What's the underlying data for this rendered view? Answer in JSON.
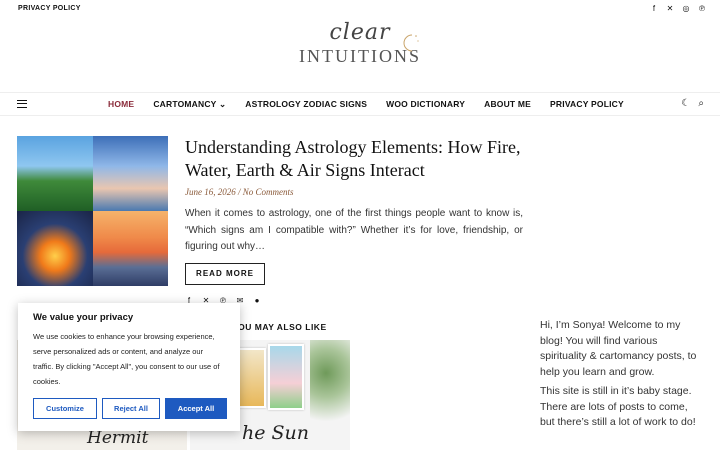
{
  "topbar": {
    "privacy_link": "PRIVACY POLICY",
    "social_icons": [
      "facebook-icon",
      "x-icon",
      "instagram-icon",
      "pinterest-icon"
    ]
  },
  "logo": {
    "script_text": "clear",
    "main_text": "INTUITIONS"
  },
  "nav": {
    "items": [
      {
        "label": "HOME",
        "active": true
      },
      {
        "label": "CARTOMANCY ⌄"
      },
      {
        "label": "ASTROLOGY ZODIAC SIGNS"
      },
      {
        "label": "WOO DICTIONARY"
      },
      {
        "label": "ABOUT ME"
      },
      {
        "label": "PRIVACY POLICY"
      }
    ]
  },
  "post": {
    "title": "Understanding Astrology Elements: How Fire, Water, Earth & Air Signs Interact",
    "meta": "June 16, 2026 / No Comments",
    "excerpt": "When it comes to astrology, one of the first things people want to know is, “Which signs am I compatible with?” Whether it’s for love, friendship, or figuring out why…",
    "read_more": "READ MORE"
  },
  "related": {
    "heading": "YOU MAY ALSO LIKE",
    "cards": [
      {
        "label": "Hermit"
      },
      {
        "label": "he Sun"
      }
    ]
  },
  "sidebar": {
    "intro": "Hi, I’m Sonya! Welcome to my blog! You will find various spirituality & cartomancy posts, to help you learn and grow.",
    "note": "This site is still in it’s baby stage. There are lots of posts to come, but there’s still a lot of work to do!"
  },
  "cookie": {
    "title": "We value your privacy",
    "text": "We use cookies to enhance your browsing experience, serve personalized ads or content, and analyze our traffic. By clicking \"Accept All\", you consent to our use of cookies.",
    "customize": "Customize",
    "reject": "Reject All",
    "accept": "Accept All",
    "accent_color": "#1e5ac0"
  }
}
